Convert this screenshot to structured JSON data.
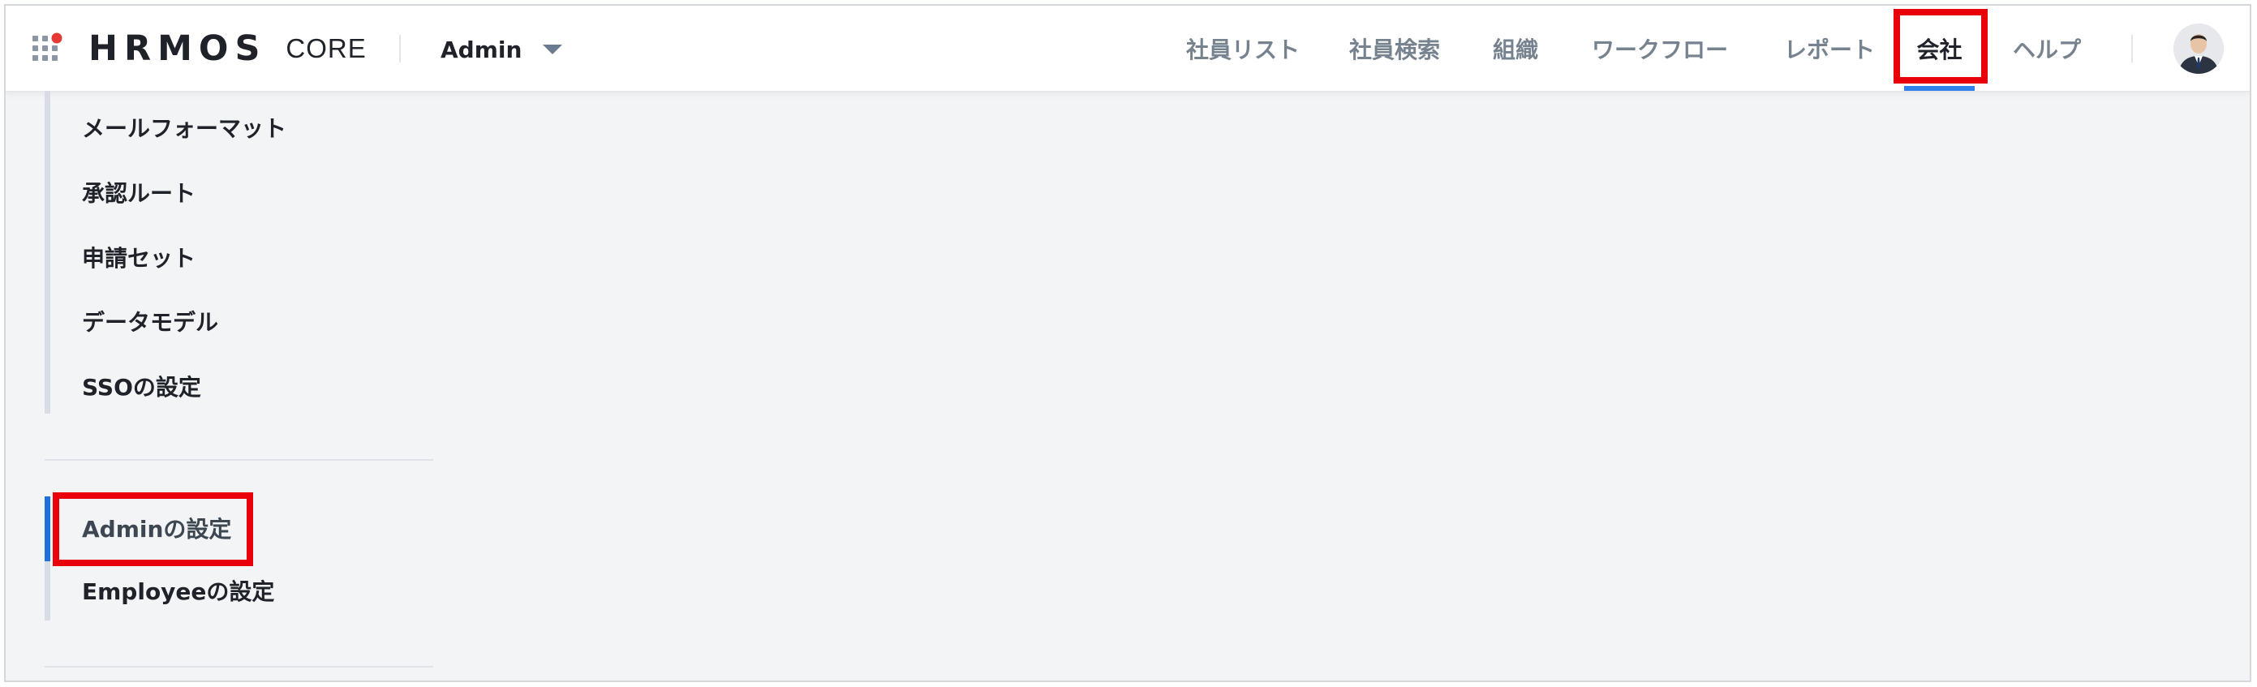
{
  "header": {
    "brand": "HRMOS",
    "brand_sub": "CORE",
    "role_switcher": {
      "label": "Admin"
    },
    "nav_items": [
      {
        "label": "社員リスト",
        "active": false
      },
      {
        "label": "社員検索",
        "active": false
      },
      {
        "label": "組織",
        "active": false
      },
      {
        "label": "ワークフロー",
        "active": false
      },
      {
        "label": "レポート",
        "active": false
      },
      {
        "label": "会社",
        "active": true
      },
      {
        "label": "ヘルプ",
        "active": false
      }
    ],
    "accent_color": "#2f80ed",
    "logo_dot_color": "#e53935"
  },
  "sidebar": {
    "group1": [
      {
        "label": "メールフォーマット"
      },
      {
        "label": "承認ルート"
      },
      {
        "label": "申請セット"
      },
      {
        "label": "データモデル"
      },
      {
        "label": "SSOの設定"
      }
    ],
    "group2": [
      {
        "label": "Adminの設定",
        "active": true
      },
      {
        "label": "Employeeの設定",
        "active": false
      }
    ]
  },
  "annotations": {
    "highlight_color": "#e8000b"
  }
}
